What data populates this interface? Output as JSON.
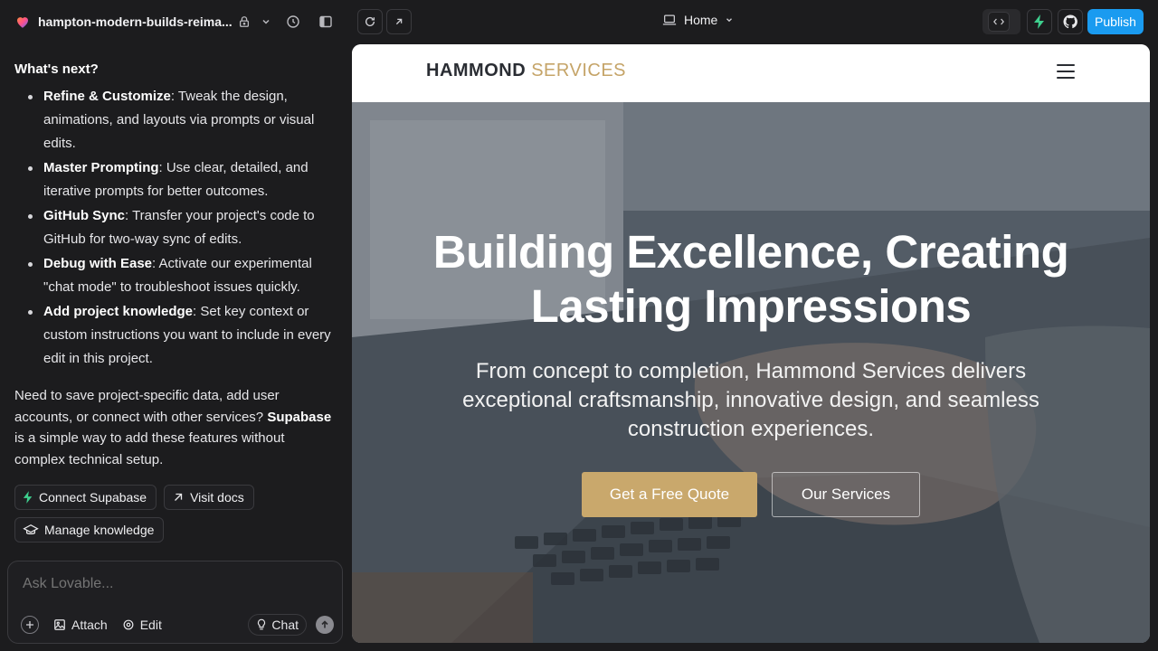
{
  "topbar": {
    "project_name": "hampton-modern-builds-reima...",
    "route_label": "Home",
    "publish_label": "Publish"
  },
  "chat": {
    "heading": "What's next?",
    "items": [
      {
        "bold": "Refine & Customize",
        "text": ": Tweak the design, animations, and layouts via prompts or visual edits."
      },
      {
        "bold": "Master Prompting",
        "text": ": Use clear, detailed, and iterative prompts for better outcomes."
      },
      {
        "bold": "GitHub Sync",
        "text": ": Transfer your project's code to GitHub for two-way sync of edits."
      },
      {
        "bold": "Debug with Ease",
        "text": ": Activate our experimental \"chat mode\" to troubleshoot issues quickly."
      },
      {
        "bold": "Add project knowledge",
        "text": ": Set key context or custom instructions you want to include in every edit in this project."
      }
    ],
    "para_1": "Need to save project-specific data, add user accounts, or connect with other services?",
    "para_bold": "Supabase",
    "para_2": " is a simple way to add these features without complex technical setup.",
    "chips": {
      "connect_supabase": "Connect Supabase",
      "visit_docs": "Visit docs",
      "manage_knowledge": "Manage knowledge"
    },
    "prompt": {
      "placeholder": "Ask Lovable...",
      "attach_label": "Attach",
      "edit_label": "Edit",
      "chat_label": "Chat"
    }
  },
  "preview": {
    "logo_primary": "HAMMOND",
    "logo_secondary": "SERVICES",
    "hero_title_line1": "Building Excellence, Creating",
    "hero_title_line2": "Lasting Impressions",
    "hero_subtitle": "From concept to completion, Hammond Services delivers exceptional craftsmanship, innovative design, and seamless construction experiences.",
    "cta_primary": "Get a Free Quote",
    "cta_secondary": "Our Services"
  },
  "colors": {
    "publish_blue": "#1a9bf0",
    "brand_gold": "#c9a86c",
    "supabase_green": "#3ecf8e",
    "dark_bg": "#1c1c1e"
  }
}
